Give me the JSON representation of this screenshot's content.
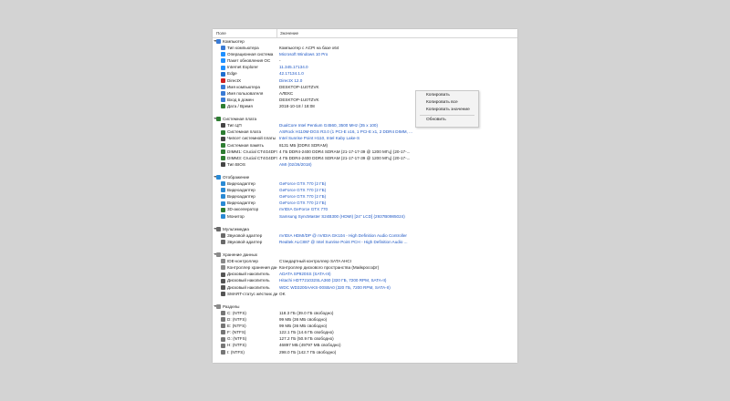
{
  "columns": {
    "field": "Поле",
    "value": "Значение"
  },
  "colors": {
    "link": "#1c56c4",
    "icon_computer": "#3a7bd5",
    "icon_board": "#2e7d32",
    "icon_cpu": "#444444",
    "icon_display": "#2a8ad4",
    "icon_audio": "#6a6a6a",
    "icon_storage": "#8a8a8a",
    "icon_win": "#1e90ff"
  },
  "context_menu": {
    "items": [
      {
        "label": "Копировать"
      },
      {
        "label": "Копировать все"
      },
      {
        "label": "Копировать значение"
      },
      {
        "label": "Обновить"
      }
    ]
  },
  "sections": [
    {
      "title": "Компьютер",
      "icon": "computer-icon",
      "color": "#3a7bd5",
      "rows": [
        {
          "field": "Тип компьютера",
          "value": "Компьютер с ACPI на базе x64",
          "link": false,
          "icon": "computer-icon",
          "color": "#3a7bd5"
        },
        {
          "field": "Операционная система",
          "value": "Microsoft Windows 10 Pro",
          "link": true,
          "icon": "windows-icon",
          "color": "#1e90ff"
        },
        {
          "field": "Пакет обновления ОС",
          "value": "-",
          "link": false,
          "icon": "windows-icon",
          "color": "#1e90ff"
        },
        {
          "field": "Internet Explorer",
          "value": "11.345.17134.0",
          "link": true,
          "icon": "ie-icon",
          "color": "#1e90ff"
        },
        {
          "field": "Edge",
          "value": "42.17134.1.0",
          "link": true,
          "icon": "edge-icon",
          "color": "#1e6fd0"
        },
        {
          "field": "DirectX",
          "value": "DirectX 12.0",
          "link": true,
          "icon": "directx-icon",
          "color": "#d02020"
        },
        {
          "field": "Имя компьютера",
          "value": "DESKTOP-1U0TZVK",
          "link": false,
          "icon": "computer-icon",
          "color": "#3a7bd5"
        },
        {
          "field": "Имя пользователя",
          "value": "АЛЕКС",
          "link": false,
          "icon": "user-icon",
          "color": "#3a7bd5"
        },
        {
          "field": "Вход в домен",
          "value": "DESKTOP-1U0TZVK",
          "link": false,
          "icon": "domain-icon",
          "color": "#3a7bd5"
        },
        {
          "field": "Дата / Время",
          "value": "2018-10-18 / 18:08",
          "link": false,
          "icon": "clock-icon",
          "color": "#2e7d32"
        }
      ]
    },
    {
      "title": "Системная плата",
      "icon": "motherboard-icon",
      "color": "#2e7d32",
      "rows": [
        {
          "field": "Тип ЦП",
          "value": "DualCore Intel Pentium G4560, 3500 MHz (35 x 100)",
          "link": true,
          "icon": "cpu-icon",
          "color": "#444444"
        },
        {
          "field": "Системная плата",
          "value": "ASRock H110M-DGS R3.0  (1 PCI-E x16, 1 PCI-E x1, 2 DDR4 DIMM, ...",
          "link": true,
          "icon": "motherboard-icon",
          "color": "#2e7d32"
        },
        {
          "field": "Чипсет системной платы",
          "value": "Intel Sunrise Point H110, Intel Kaby Lake-S",
          "link": true,
          "icon": "chip-icon",
          "color": "#444444"
        },
        {
          "field": "Системная память",
          "value": "8131 МБ  (DDR4 SDRAM)",
          "link": false,
          "icon": "memory-icon",
          "color": "#2e7d32"
        },
        {
          "field": "DIMM1: Crucial CT4G4DFS8...",
          "value": "4 ГБ DDR4-2400 DDR4 SDRAM  (21-17-17-39 @ 1200 МГц)  (20-17-...",
          "link": false,
          "icon": "memory-icon",
          "color": "#2e7d32"
        },
        {
          "field": "DIMM3: Crucial CT4G4DFS8...",
          "value": "4 ГБ DDR4-2400 DDR4 SDRAM  (21-17-17-39 @ 1200 МГц)  (20-17-...",
          "link": false,
          "icon": "memory-icon",
          "color": "#2e7d32"
        },
        {
          "field": "Тип BIOS",
          "value": "AMI (02/26/2018)",
          "link": true,
          "icon": "bios-icon",
          "color": "#444444"
        }
      ]
    },
    {
      "title": "Отображение",
      "icon": "display-icon",
      "color": "#2a8ad4",
      "rows": [
        {
          "field": "Видеоадаптер",
          "value": "GeForce GTX 770  (2 ГБ)",
          "link": true,
          "icon": "display-icon",
          "color": "#2a8ad4"
        },
        {
          "field": "Видеоадаптер",
          "value": "GeForce GTX 770  (2 ГБ)",
          "link": true,
          "icon": "display-icon",
          "color": "#2a8ad4"
        },
        {
          "field": "Видеоадаптер",
          "value": "GeForce GTX 770  (2 ГБ)",
          "link": true,
          "icon": "display-icon",
          "color": "#2a8ad4"
        },
        {
          "field": "Видеоадаптер",
          "value": "GeForce GTX 770  (2 ГБ)",
          "link": true,
          "icon": "display-icon",
          "color": "#2a8ad4"
        },
        {
          "field": "3D-акселератор",
          "value": "nVIDIA GeForce GTX 770",
          "link": true,
          "icon": "accelerator-icon",
          "color": "#2e7d32"
        },
        {
          "field": "Монитор",
          "value": "Samsung SyncMaster S24B300 (HDMI)  [24\" LCD]  (2937B0985024)",
          "link": true,
          "icon": "monitor-icon",
          "color": "#2a8ad4"
        }
      ]
    },
    {
      "title": "Мультимедиа",
      "icon": "multimedia-icon",
      "color": "#6a6a6a",
      "rows": [
        {
          "field": "Звуковой адаптер",
          "value": "nVIDIA HDMI/DP @ nVIDIA GK104 - High Definition Audio Controller",
          "link": true,
          "icon": "speaker-icon",
          "color": "#6a6a6a"
        },
        {
          "field": "Звуковой адаптер",
          "value": "Realtek ALC887 @ Intel Sunrise Point PCH - High Definition Audio ...",
          "link": true,
          "icon": "speaker-icon",
          "color": "#6a6a6a"
        }
      ]
    },
    {
      "title": "Хранение данных",
      "icon": "storage-icon",
      "color": "#8a8a8a",
      "rows": [
        {
          "field": "IDE-контроллер",
          "value": "Стандартный контроллер SATA AHCI",
          "link": false,
          "icon": "controller-icon",
          "color": "#8a8a8a"
        },
        {
          "field": "Контроллер хранения данн",
          "value": "Контроллер дискового пространства (Майкрософт)",
          "link": false,
          "icon": "controller-icon",
          "color": "#8a8a8a"
        },
        {
          "field": "Дисковый накопитель",
          "value": "ADATA SP920SS  (SATA-III)",
          "link": true,
          "icon": "disk-icon",
          "color": "#555555"
        },
        {
          "field": "Дисковый накопитель",
          "value": "Hitachi HDT721032SLA360  (320 ГБ, 7200 RPM, SATA-II)",
          "link": true,
          "icon": "disk-icon",
          "color": "#555555"
        },
        {
          "field": "Дисковый накопитель",
          "value": "WDC WD3200AAKS-00SBA0  (320 ГБ, 7200 RPM, SATA-II)",
          "link": true,
          "icon": "disk-icon",
          "color": "#555555"
        },
        {
          "field": "SMART-статус жёстких дис",
          "value": "OK",
          "link": false,
          "icon": "smart-icon",
          "color": "#555555"
        }
      ]
    },
    {
      "title": "Разделы",
      "icon": "partition-icon",
      "color": "#8a8a8a",
      "rows": [
        {
          "field": "C: (NTFS)",
          "value": "118.3 ГБ (39.0 ГБ свободно)",
          "link": false,
          "icon": "drive-icon",
          "color": "#777777"
        },
        {
          "field": "D: (NTFS)",
          "value": "99 МБ (36 МБ свободно)",
          "link": false,
          "icon": "drive-icon",
          "color": "#777777"
        },
        {
          "field": "E: (NTFS)",
          "value": "99 МБ (36 МБ свободно)",
          "link": false,
          "icon": "drive-icon",
          "color": "#777777"
        },
        {
          "field": "F: (NTFS)",
          "value": "122.1 ГБ (14.6 ГБ свободно)",
          "link": false,
          "icon": "drive-icon",
          "color": "#777777"
        },
        {
          "field": "G: (NTFS)",
          "value": "127.2 ГБ (50.9 ГБ свободно)",
          "link": false,
          "icon": "drive-icon",
          "color": "#777777"
        },
        {
          "field": "H: (NTFS)",
          "value": "46897 МБ (49797 МБ свободно)",
          "link": false,
          "icon": "drive-icon",
          "color": "#777777"
        },
        {
          "field": "I: (NTFS)",
          "value": "298.0 ГБ (142.7 ГБ свободно)",
          "link": false,
          "icon": "drive-icon",
          "color": "#777777"
        }
      ]
    }
  ]
}
